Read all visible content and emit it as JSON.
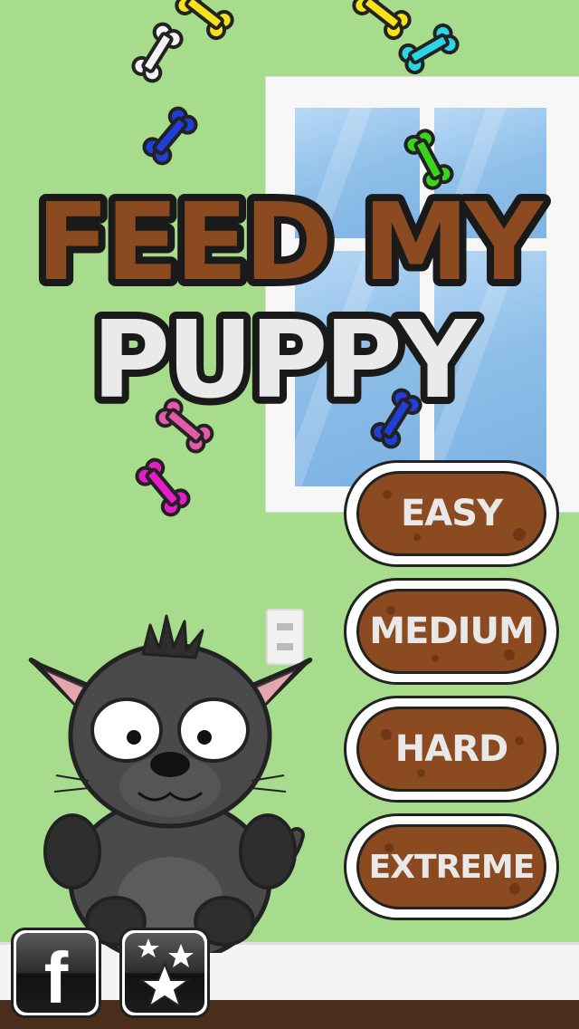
{
  "title": {
    "line1": "FEED MY",
    "line2": "PUPPY"
  },
  "menu": {
    "easy": "EASY",
    "medium": "MEDIUM",
    "hard": "HARD",
    "extreme": "EXTREME"
  },
  "social": {
    "facebook_glyph": "f"
  },
  "icons": [
    "bone-icon",
    "facebook-icon",
    "stars-icon",
    "puppy-character",
    "wall-outlet",
    "window"
  ],
  "colors": {
    "wall": "#a6dc8c",
    "brown": "#8b4a1f",
    "floor": "#4a2d1a",
    "button_text": "#e8e8e8"
  }
}
